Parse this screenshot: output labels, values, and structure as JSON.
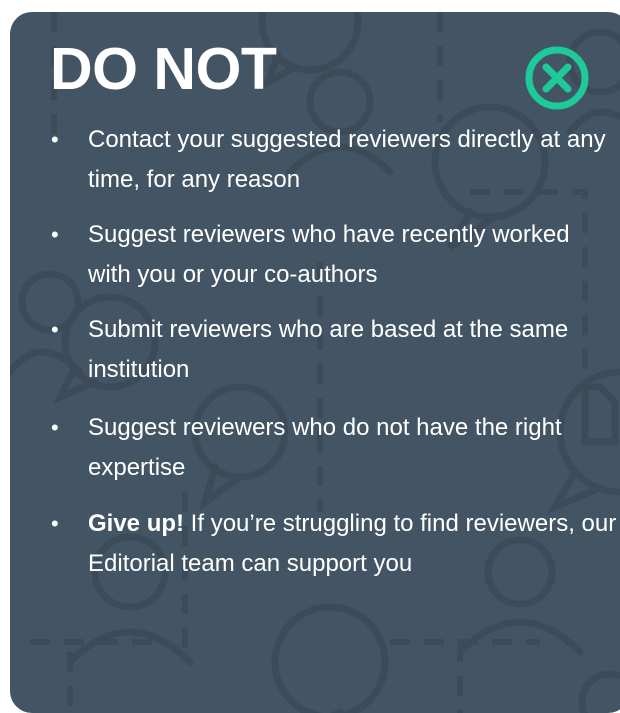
{
  "title": "DO NOT",
  "icon": "close-circle-icon",
  "colors": {
    "card_bg": "#435564",
    "pattern": "#3b4b59",
    "accent": "#1ec99a",
    "text": "#ffffff"
  },
  "items": [
    {
      "bold": "",
      "text": "Contact your suggested reviewers directly at any time, for any reason"
    },
    {
      "bold": "",
      "text": "Suggest reviewers who have recently worked with you or your co-authors"
    },
    {
      "bold": "",
      "text": "Submit reviewers who are based at the same institution"
    },
    {
      "bold": "",
      "text": "Suggest reviewers who do not have the right expertise"
    },
    {
      "bold": "Give up!",
      "text": " If you’re struggling to find reviewers, our Editorial team can support you"
    }
  ]
}
